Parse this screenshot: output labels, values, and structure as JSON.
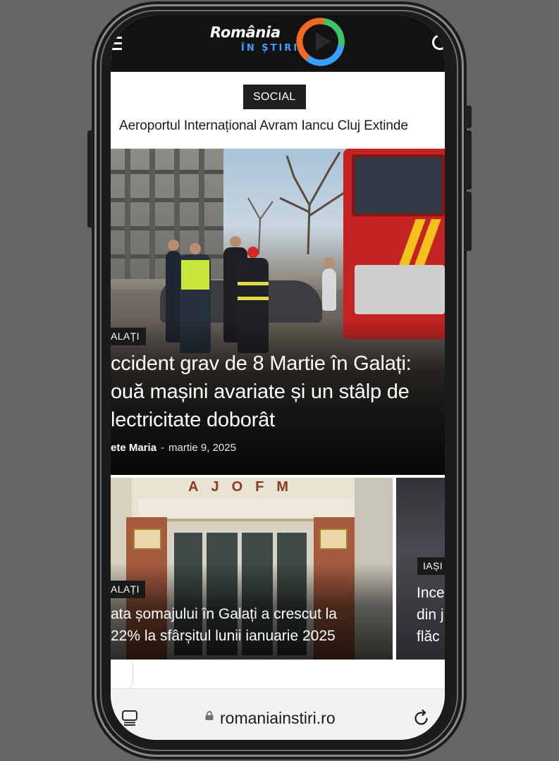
{
  "header": {
    "logo_word1": "România",
    "logo_word2": "ÎN ȘTIRI",
    "menu_icon": "menu-icon",
    "search_icon": "search-icon"
  },
  "featured_top": {
    "category": "SOCIAL",
    "headline": "Aeroportul Internațional Avram Iancu Cluj Extinde"
  },
  "hero": {
    "category": "ALAȚI",
    "title_lines": [
      "ccident grav de 8 Martie în Galați:",
      "ouă mașini avariate și un stâlp de",
      "lectricitate doborât"
    ],
    "author": "ete Maria",
    "separator": "-",
    "date": "martie 9, 2025"
  },
  "cards": [
    {
      "category": "ALAȚI",
      "sign_text": "AJOFM",
      "title_lines": [
        "ata șomajului în Galați a crescut la",
        "22% la sfârșitul lunii ianuarie 2025"
      ]
    },
    {
      "category": "IAȘI",
      "title_lines": [
        "Ince",
        "din j",
        "flăc"
      ]
    }
  ],
  "browser": {
    "url": "romaniainstiri.ro",
    "tabs_icon": "tabs-icon",
    "lock_icon": "lock-icon",
    "reload_icon": "reload-icon"
  },
  "colors": {
    "header_bg": "#121212",
    "badge_bg": "#1f1f1f",
    "logo_blue": "#3aa0ff",
    "logo_orange": "#f26a22",
    "logo_green": "#3cc46a"
  }
}
